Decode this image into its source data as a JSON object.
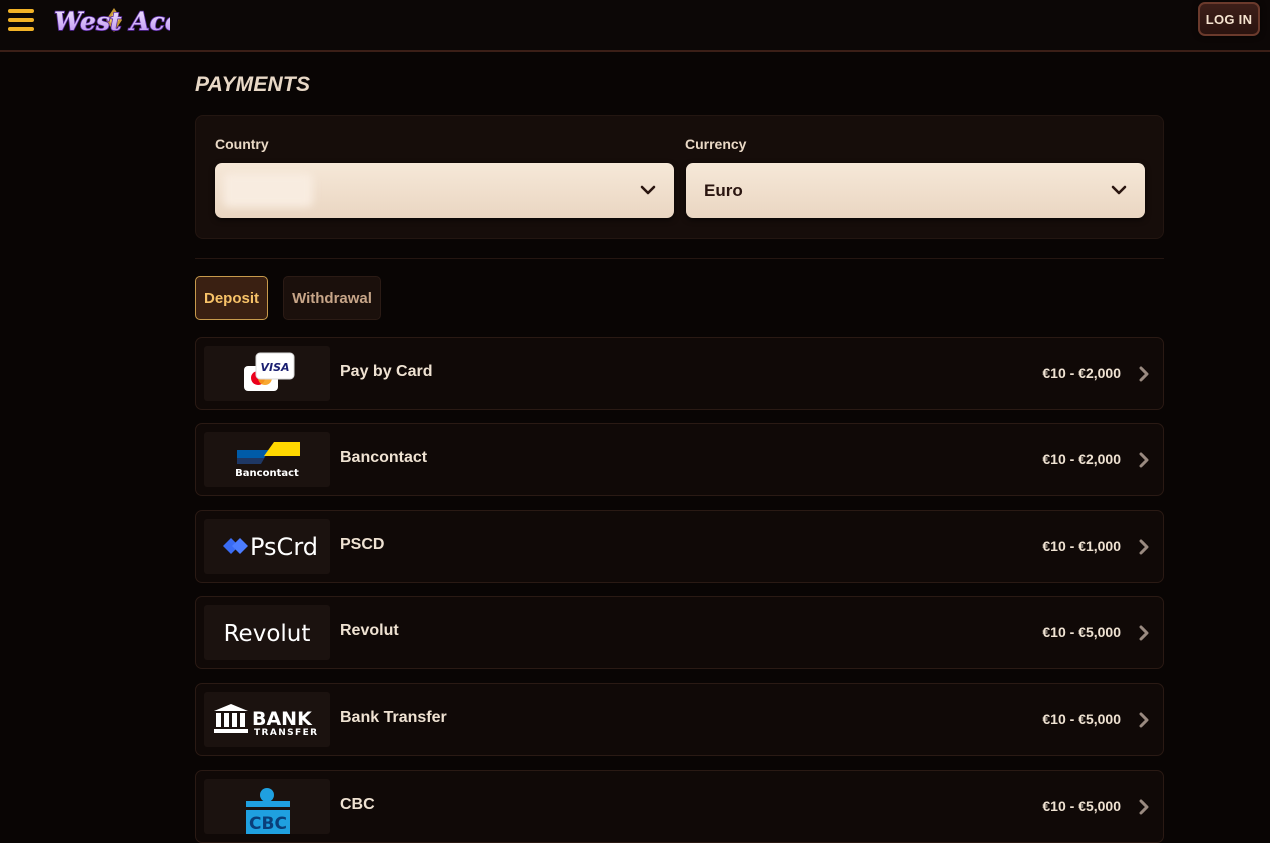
{
  "header": {
    "logo_text": "West Ace",
    "login_label": "LOG IN"
  },
  "page": {
    "title": "PAYMENTS"
  },
  "filters": {
    "country_label": "Country",
    "country_value": "",
    "currency_label": "Currency",
    "currency_value": "Euro"
  },
  "tabs": [
    {
      "label": "Deposit",
      "active": true
    },
    {
      "label": "Withdrawal",
      "active": false
    }
  ],
  "methods": [
    {
      "name": "Pay by Card",
      "range": "€10 - €2,000",
      "logo": "card-logo"
    },
    {
      "name": "Bancontact",
      "range": "€10 - €2,000",
      "logo": "bancontact-logo",
      "logo_text": "Bancontact"
    },
    {
      "name": "PSCD",
      "range": "€10 - €1,000",
      "logo": "pscrd-logo",
      "logo_text": "PsCrd"
    },
    {
      "name": "Revolut",
      "range": "€10 - €5,000",
      "logo": "revolut-logo",
      "logo_text": "Revolut"
    },
    {
      "name": "Bank Transfer",
      "range": "€10 - €5,000",
      "logo": "bank-transfer-logo",
      "logo_text": "BANK",
      "logo_subtext": "TRANSFER"
    },
    {
      "name": "CBC",
      "range": "€10 - €5,000",
      "logo": "cbc-logo",
      "logo_text": "CBC"
    }
  ],
  "colors": {
    "background": "#090504",
    "accent": "#f2b227",
    "select_bg": "#f6e8d8",
    "active_tab_text": "#f7c268"
  }
}
